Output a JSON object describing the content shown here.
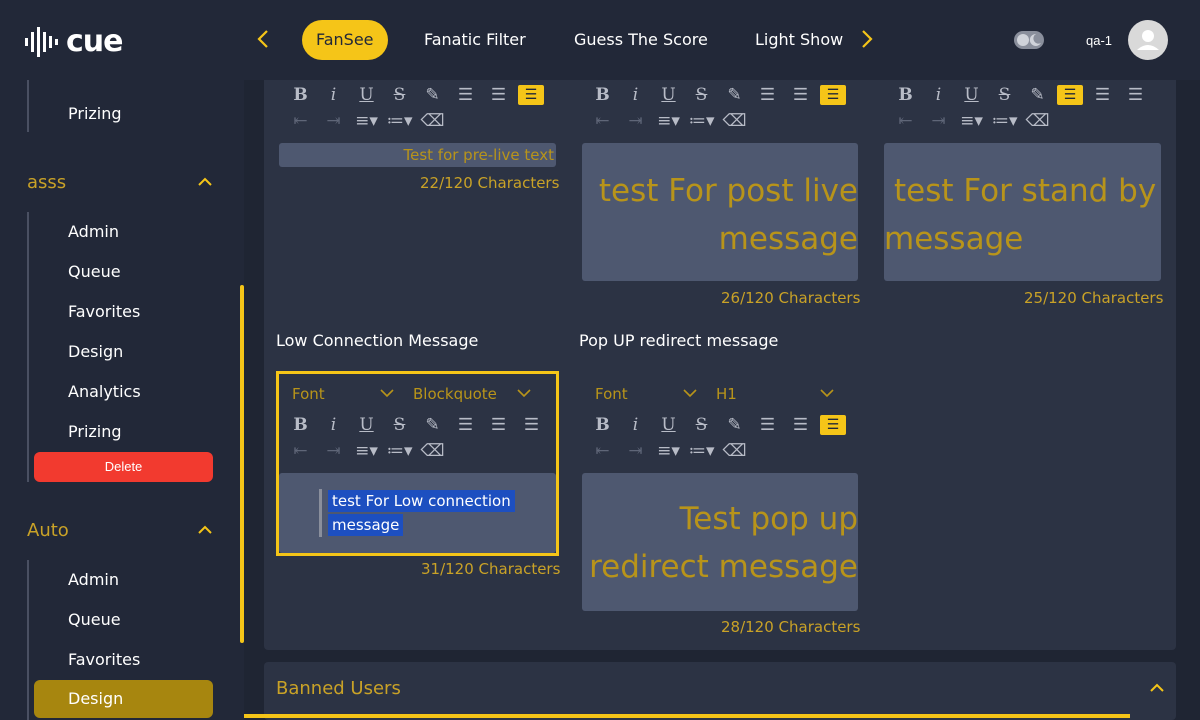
{
  "header": {
    "logo_text": "cue",
    "tabs": [
      {
        "label": "FanSee",
        "active": true
      },
      {
        "label": "Fanatic Filter"
      },
      {
        "label": "Guess The Score"
      },
      {
        "label": "Light Show"
      }
    ],
    "prev_icon": "chevron-left-icon",
    "next_icon": "chevron-right-icon",
    "username": "qa-1",
    "accent": "#f5c518"
  },
  "sidebar": {
    "top_items": [
      "Prizing"
    ],
    "groups": [
      {
        "title": "asss",
        "items": [
          "Admin",
          "Queue",
          "Favorites",
          "Design",
          "Analytics",
          "Prizing"
        ],
        "delete_label": "Delete"
      },
      {
        "title": "Auto",
        "items": [
          "Admin",
          "Queue",
          "Favorites",
          "Design"
        ],
        "active_item": "Design"
      }
    ]
  },
  "editors": {
    "pre_live": {
      "text": "Test for pre-live text",
      "count": "22/120 Characters"
    },
    "post_live": {
      "text_line1": "test For post live",
      "text_line2": "message",
      "count": "26/120 Characters"
    },
    "stand_by": {
      "text_line1": "test For stand by",
      "text_line2": "message",
      "count": "25/120 Characters"
    },
    "low_connection": {
      "label": "Low Connection Message",
      "font": "Font",
      "format": "Blockquote",
      "text_line1": "test For Low connection",
      "text_line2": "message",
      "count": "31/120 Characters"
    },
    "popup_redirect": {
      "label": "Pop UP redirect message",
      "font": "Font",
      "format": "H1",
      "text_line1": "Test pop up",
      "text_line2": "redirect message",
      "count": "28/120 Characters"
    }
  },
  "banned_users": {
    "title": "Banned Users"
  }
}
